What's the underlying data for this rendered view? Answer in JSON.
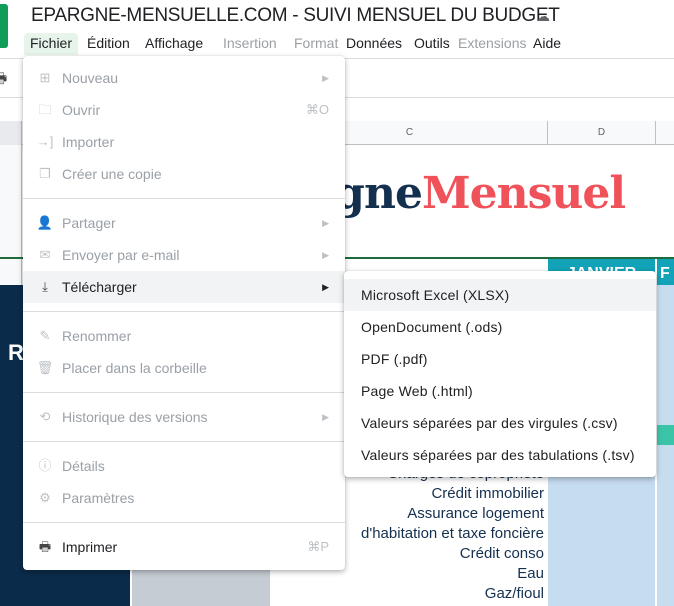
{
  "title": "EPARGNE-MENSUELLE.COM - SUIVI MENSUEL DU BUDGET",
  "menubar": [
    {
      "label": "Fichier",
      "enabled": true
    },
    {
      "label": "Édition",
      "enabled": true
    },
    {
      "label": "Affichage",
      "enabled": true
    },
    {
      "label": "Insertion",
      "enabled": false
    },
    {
      "label": "Format",
      "enabled": false
    },
    {
      "label": "Données",
      "enabled": true
    },
    {
      "label": "Outils",
      "enabled": true
    },
    {
      "label": "Extensions",
      "enabled": false
    },
    {
      "label": "Aide",
      "enabled": true
    }
  ],
  "columns": [
    "C",
    "D"
  ],
  "sheet": {
    "brand_a": "rgne",
    "brand_b": "Mensuel",
    "left_letter": "R",
    "month": "JANVIER",
    "month2": "F",
    "labels": [
      "Charges de copropriété",
      "Crédit immobilier",
      "Assurance logement",
      "d'habitation et taxe foncière",
      "Crédit conso",
      "Eau",
      "Gaz/fioul"
    ]
  },
  "file_menu": [
    [
      {
        "label": "Nouveau",
        "icon": "plus-icon",
        "submenu": true,
        "enabled": false
      },
      {
        "label": "Ouvrir",
        "icon": "folder-icon",
        "shortcut": "⌘O",
        "enabled": false
      },
      {
        "label": "Importer",
        "icon": "import-icon",
        "enabled": false
      },
      {
        "label": "Créer une copie",
        "icon": "copy-icon",
        "enabled": false
      }
    ],
    [
      {
        "label": "Partager",
        "icon": "person-add-icon",
        "submenu": true,
        "enabled": false
      },
      {
        "label": "Envoyer par e-mail",
        "icon": "mail-icon",
        "submenu": true,
        "enabled": false
      },
      {
        "label": "Télécharger",
        "icon": "download-icon",
        "submenu": true,
        "enabled": true,
        "highlighted": true
      }
    ],
    [
      {
        "label": "Renommer",
        "icon": "pencil-icon",
        "enabled": false
      },
      {
        "label": "Placer dans la corbeille",
        "icon": "trash-icon",
        "enabled": false
      }
    ],
    [
      {
        "label": "Historique des versions",
        "icon": "history-icon",
        "submenu": true,
        "enabled": false
      }
    ],
    [
      {
        "label": "Détails",
        "icon": "info-icon",
        "enabled": false
      },
      {
        "label": "Paramètres",
        "icon": "gear-icon",
        "enabled": false
      }
    ],
    [
      {
        "label": "Imprimer",
        "icon": "printer-icon",
        "shortcut": "⌘P",
        "enabled": true
      }
    ]
  ],
  "download_menu": [
    "Microsoft Excel (XLSX)",
    "OpenDocument (.ods)",
    "PDF (.pdf)",
    "Page Web (.html)",
    "Valeurs séparées par des virgules (.csv)",
    "Valeurs séparées par des tabulations (.tsv)"
  ],
  "colors": {
    "accent": "#0f9d58",
    "navy": "#14304f",
    "red": "#f0525a",
    "teal": "#13a3b8"
  }
}
